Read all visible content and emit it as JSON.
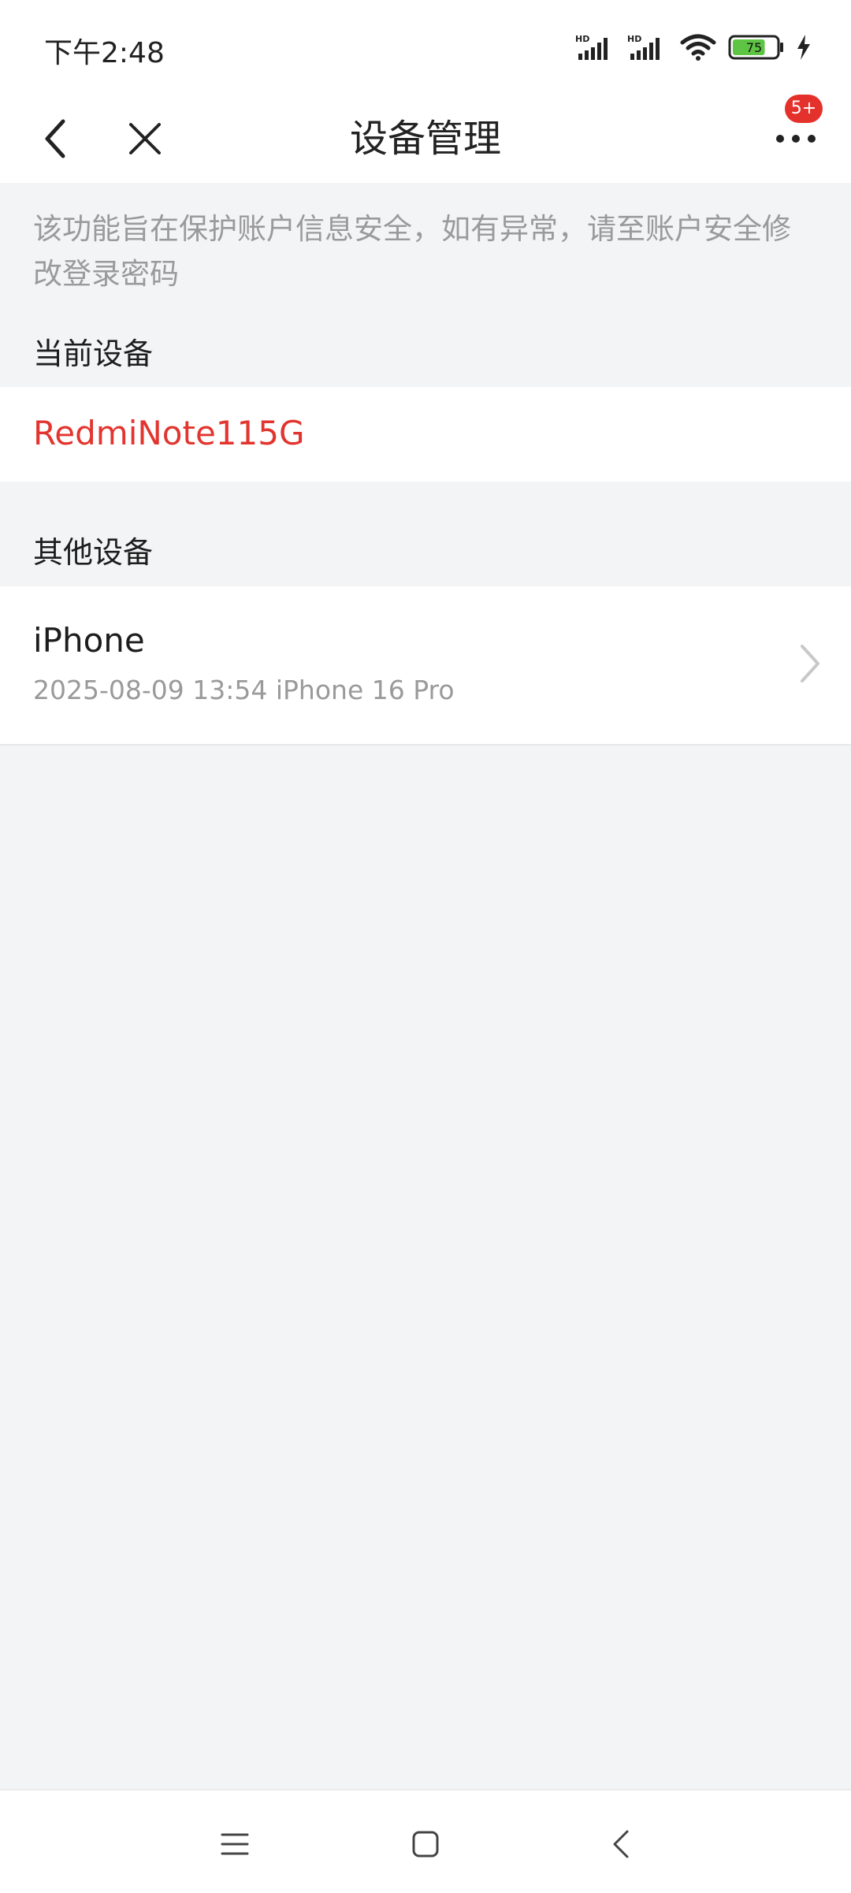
{
  "status_bar": {
    "time": "下午2:48",
    "battery_level": "75",
    "network_tag": "HD"
  },
  "header": {
    "title": "设备管理",
    "badge": "5+"
  },
  "notice": "该功能旨在保护账户信息安全，如有异常，请至账户安全修改登录密码",
  "current_section": {
    "label": "当前设备",
    "device_name": "RedmiNote115G"
  },
  "other_section": {
    "label": "其他设备",
    "devices": [
      {
        "name": "iPhone",
        "detail": "2025-08-09 13:54 iPhone 16 Pro"
      }
    ]
  },
  "colors": {
    "accent_red": "#e2352f",
    "badge_red": "#e5312b",
    "background": "#f3f4f6",
    "battery_green": "#5ec443"
  },
  "icons": {
    "back": "back-arrow-icon",
    "close": "close-icon",
    "more": "more-dots-icon",
    "chevron": "chevron-right-icon",
    "menu": "menu-icon",
    "home": "home-icon",
    "sys_back": "system-back-icon"
  }
}
